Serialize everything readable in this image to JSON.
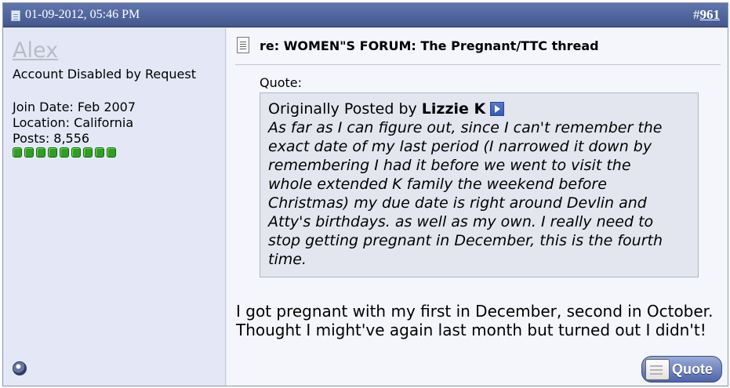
{
  "post": {
    "date": "01-09-2012, 05:46 PM",
    "number_prefix": "#",
    "number": "961"
  },
  "user": {
    "name": "Alex",
    "title": "Account Disabled by Request",
    "join_date": "Join Date: Feb 2007",
    "location": "Location: California",
    "posts": "Posts: 8,556",
    "reputation_count": 9
  },
  "content": {
    "title": "re: WOMEN\"S FORUM: The Pregnant/TTC thread",
    "quote_label": "Quote:",
    "quote_prefix": "Originally Posted by",
    "quote_author": "Lizzie K",
    "quote_text": "As far as I can figure out, since I can't remember the\nexact date of my last period (I narrowed it down by\nremembering I had it before we went to visit the\nwhole extended K family the weekend before\nChristmas) my due date is right around Devlin and\nAtty's birthdays. as well as my own. I really need to\nstop getting pregnant in December, this is the fourth\ntime.",
    "message": "I got pregnant with my first in December, second in October.\nThought I might've again last month but turned out I didn't!"
  },
  "actions": {
    "quote_button": "Quote"
  },
  "icons": {
    "post_icon": "post-icon",
    "title_icon": "document-icon",
    "view_post_icon": "view-post-icon",
    "online_status_icon": "offline-status-icon"
  },
  "colors": {
    "header": "#4f65a0",
    "left_column": "#e4e8f6",
    "right_column": "#f4f6fc",
    "reputation": "#2f9f22"
  }
}
